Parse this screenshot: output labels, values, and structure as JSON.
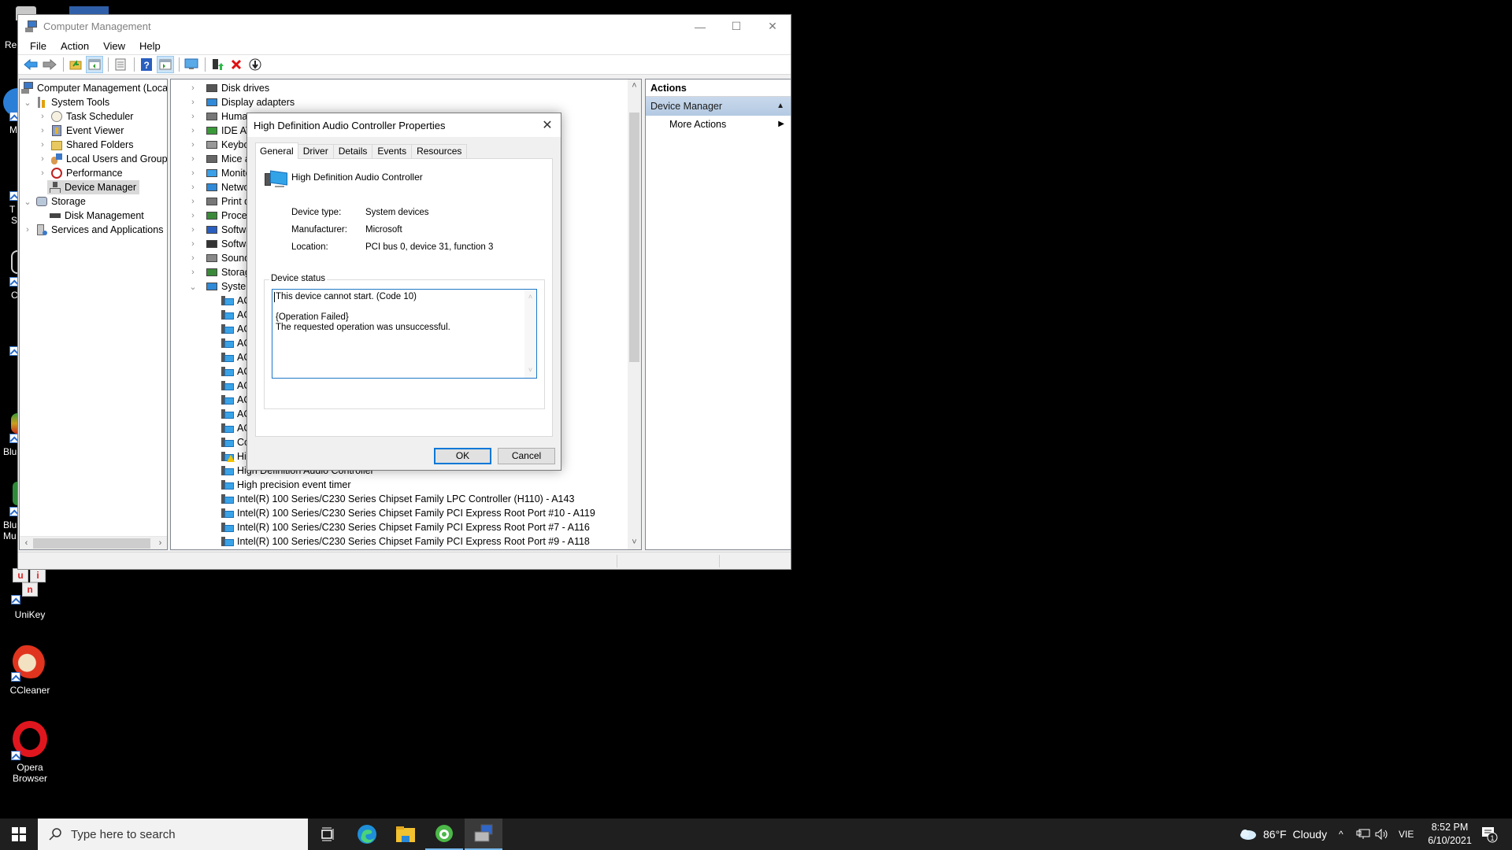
{
  "desktop": {
    "icons": [
      {
        "label": "Re",
        "name": "recycle-bin"
      },
      {
        "label": "M",
        "name": "desktop-app-m"
      },
      {
        "label": "T S",
        "name": "desktop-app-t"
      },
      {
        "label": "C",
        "name": "desktop-app-c"
      },
      {
        "label": "Blu",
        "name": "desktop-app-blu"
      },
      {
        "label": "Blu Mu",
        "name": "desktop-app-blu-mu"
      },
      {
        "label": "UniKey",
        "name": "unikey"
      },
      {
        "label": "CCleaner",
        "name": "ccleaner"
      },
      {
        "label": "Opera Browser",
        "name": "opera-browser"
      }
    ]
  },
  "window": {
    "title": "Computer Management",
    "controls": {
      "minimize": "—",
      "maximize": "☐",
      "close": "✕"
    },
    "menu": [
      "File",
      "Action",
      "View",
      "Help"
    ],
    "toolbar": [
      "back",
      "forward",
      "up-folder",
      "show-hide-console-tree",
      "properties",
      "help",
      "show-hide-action-pane",
      "monitor",
      "enable-device",
      "uninstall-device",
      "update-driver"
    ]
  },
  "tree": {
    "root": "Computer Management (Local",
    "items": [
      {
        "label": "System Tools",
        "level": 1,
        "expander": "open"
      },
      {
        "label": "Task Scheduler",
        "level": 2,
        "expander": "closed"
      },
      {
        "label": "Event Viewer",
        "level": 2,
        "expander": "closed"
      },
      {
        "label": "Shared Folders",
        "level": 2,
        "expander": "closed"
      },
      {
        "label": "Local Users and Groups",
        "level": 2,
        "expander": "closed"
      },
      {
        "label": "Performance",
        "level": 2,
        "expander": "closed"
      },
      {
        "label": "Device Manager",
        "level": 2,
        "expander": "none",
        "selected": true
      },
      {
        "label": "Storage",
        "level": 1,
        "expander": "open"
      },
      {
        "label": "Disk Management",
        "level": 2,
        "expander": "none"
      },
      {
        "label": "Services and Applications",
        "level": 1,
        "expander": "closed"
      }
    ]
  },
  "devices": {
    "categories": [
      "Disk drives",
      "Display adapters",
      "Human Interface Devices",
      "IDE ATA/ATAPI controllers",
      "Keyboards",
      "Mice and other pointing devices",
      "Monitors",
      "Network adapters",
      "Print queues",
      "Processors",
      "Software components",
      "Software devices",
      "Sound, video and game controllers",
      "Storage controllers",
      "System devices"
    ],
    "visible_categories": [
      "Disk drives",
      "Display adapters",
      "Human",
      "IDE ATA",
      "Keybo",
      "Mice a",
      "Monito",
      "Netwo",
      "Print q",
      "Proces",
      "Softwa",
      "Softwa",
      "Sound,",
      "Storag",
      "System"
    ],
    "system_children": [
      "AC",
      "AC",
      "AC",
      "AC",
      "AC",
      "AC",
      "AC",
      "AC",
      "AC",
      "AC",
      "Co",
      "Hig",
      "High Definition Audio Controller",
      "High precision event timer",
      "Intel(R) 100 Series/C230 Series Chipset Family LPC Controller (H110) - A143",
      "Intel(R) 100 Series/C230 Series Chipset Family PCI Express Root Port #10 - A119",
      "Intel(R) 100 Series/C230 Series Chipset Family PCI Express Root Port #7 - A116",
      "Intel(R) 100 Series/C230 Series Chipset Family PCI Express Root Port #9 - A118"
    ]
  },
  "actions": {
    "header": "Actions",
    "section": "Device Manager",
    "more": "More Actions"
  },
  "dialog": {
    "title": "High Definition Audio Controller Properties",
    "tabs": [
      "General",
      "Driver",
      "Details",
      "Events",
      "Resources"
    ],
    "active_tab": "General",
    "device_name": "High Definition Audio Controller",
    "props": [
      {
        "label": "Device type:",
        "value": "System devices"
      },
      {
        "label": "Manufacturer:",
        "value": "Microsoft"
      },
      {
        "label": "Location:",
        "value": "PCI bus 0, device 31, function 3"
      }
    ],
    "status_label": "Device status",
    "status_lines": [
      "This device cannot start. (Code 10)",
      "",
      "{Operation Failed}",
      "The requested operation was unsuccessful."
    ],
    "ok": "OK",
    "cancel": "Cancel"
  },
  "taskbar": {
    "search_placeholder": "Type here to search",
    "weather": "86°F  Cloudy",
    "language": "VIE",
    "time": "8:52 PM",
    "date": "6/10/2021",
    "notifications": "1"
  }
}
